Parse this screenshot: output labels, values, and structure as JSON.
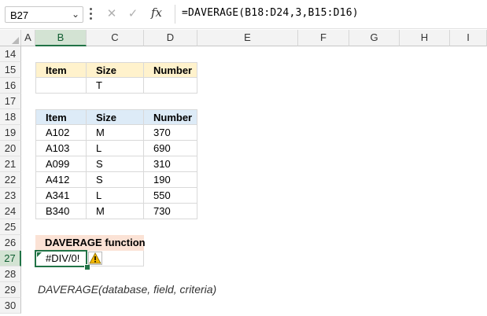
{
  "formula_bar": {
    "name_box": "B27",
    "formula": "=DAVERAGE(B18:D24,3,B15:D16)",
    "icons": [
      "cancel-x-icon",
      "confirm-check-icon",
      "insert-function-fx-icon"
    ]
  },
  "columns": [
    "A",
    "B",
    "C",
    "D",
    "E",
    "F",
    "G",
    "H",
    "I"
  ],
  "rows": [
    "14",
    "15",
    "16",
    "17",
    "18",
    "19",
    "20",
    "21",
    "22",
    "23",
    "24",
    "25",
    "26",
    "27",
    "28",
    "29",
    "30"
  ],
  "criteria_table": {
    "headers": [
      "Item",
      "Size",
      "Number"
    ],
    "row": [
      "",
      "T",
      ""
    ]
  },
  "data_table": {
    "headers": [
      "Item",
      "Size",
      "Number"
    ],
    "rows": [
      [
        "A102",
        "M",
        "370"
      ],
      [
        "A103",
        "L",
        "690"
      ],
      [
        "A099",
        "S",
        "310"
      ],
      [
        "A412",
        "S",
        "190"
      ],
      [
        "A341",
        "L",
        "550"
      ],
      [
        "B340",
        "M",
        "730"
      ]
    ]
  },
  "result": {
    "label": "DAVERAGE function",
    "value": "#DIV/0!",
    "warning_icon": "warning-triangle-icon"
  },
  "syntax_note": "DAVERAGE(database, field, criteria)",
  "colors": {
    "selection": "#217346",
    "criteria_header": "#fff2cc",
    "data_header": "#ddebf7",
    "result_header": "#fbe2d5"
  }
}
